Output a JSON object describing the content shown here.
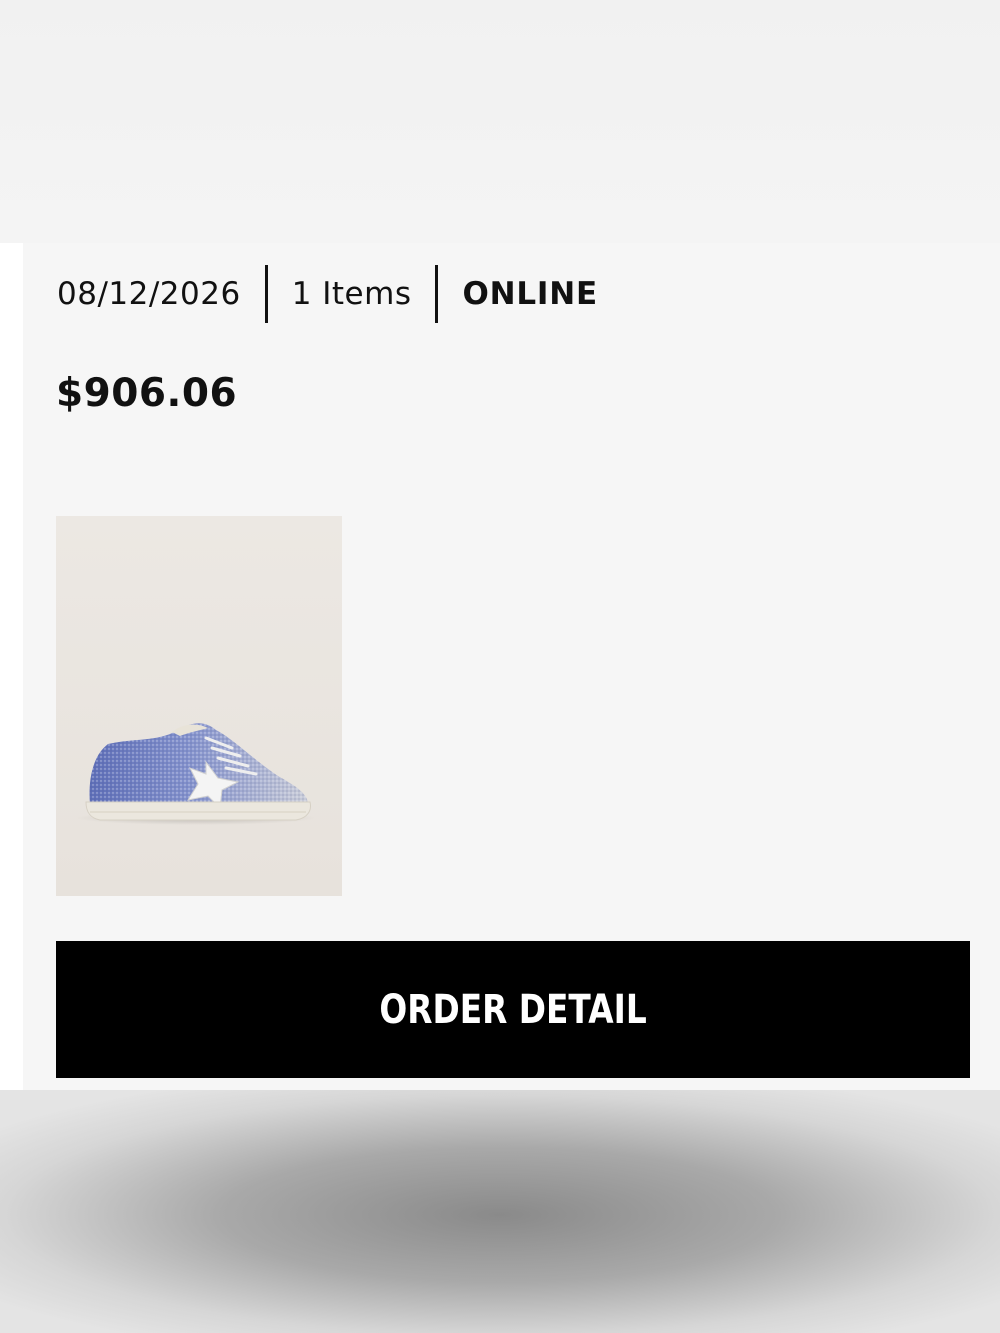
{
  "order": {
    "date": "08/12/2026",
    "items_label": "1 Items",
    "channel": "ONLINE",
    "total": "$906.06",
    "product_image": {
      "description_icon": "glitter-sneaker-image",
      "colors": {
        "glitter_blue": "#6f7fc0",
        "glitter_silver": "#c7cad6",
        "sole": "#e9e5dc",
        "background": "#e9e4de"
      }
    }
  },
  "actions": {
    "order_detail_label": "ORDER DETAIL"
  },
  "colors": {
    "button_bg": "#000000",
    "button_text": "#ffffff",
    "card_bg": "#f6f6f6",
    "text": "#111111"
  }
}
